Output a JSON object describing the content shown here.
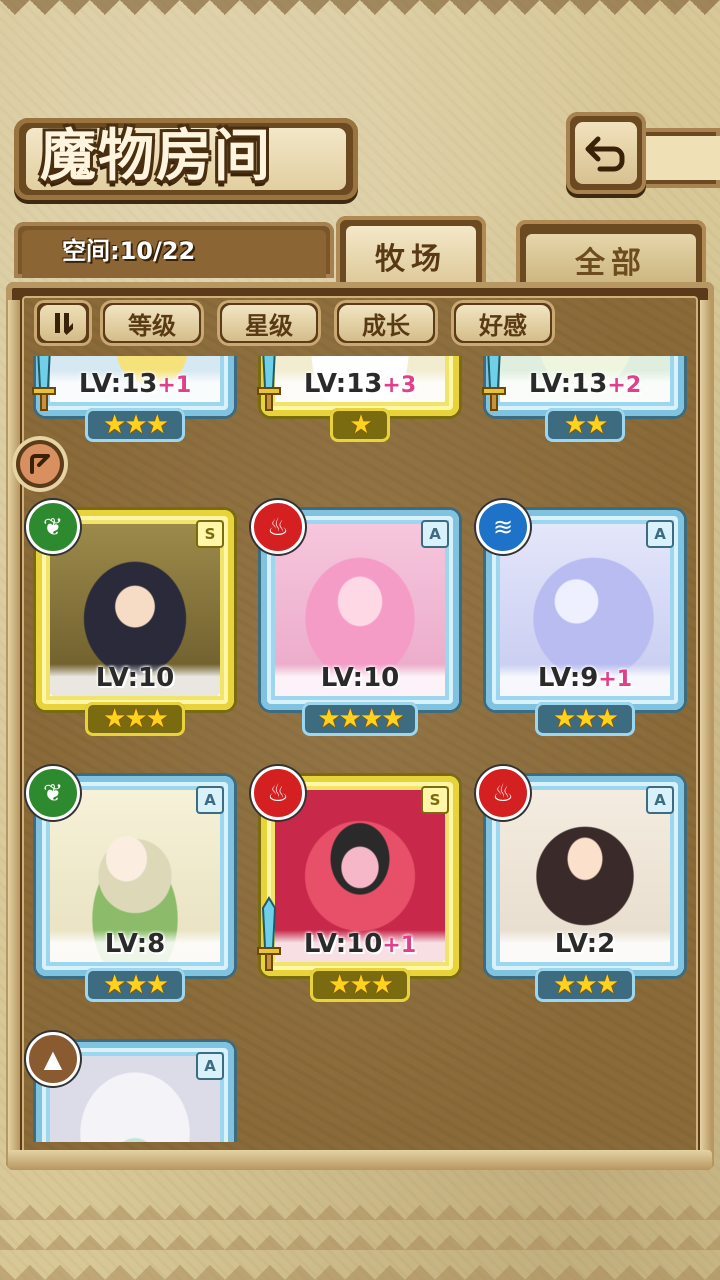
{
  "header": {
    "title": "魔物房间",
    "back_icon": "return-arrow-icon"
  },
  "capacity": {
    "text": "空间:10/22"
  },
  "tabs": [
    {
      "label": "牧场",
      "active": true
    },
    {
      "label": "全部",
      "active": false
    }
  ],
  "sort": {
    "toggle_icon": "pause-sort-icon",
    "buttons": [
      {
        "label": "等级"
      },
      {
        "label": "星级"
      },
      {
        "label": "成长"
      },
      {
        "label": "好感"
      }
    ]
  },
  "monsters": [
    {
      "lv": "LV:13",
      "plus": "+1",
      "stars": "★★★",
      "frame": "blue",
      "element": "",
      "rank": "",
      "weapon": true,
      "partial": true
    },
    {
      "lv": "LV:13",
      "plus": "+3",
      "stars": "★",
      "frame": "gold",
      "element": "",
      "rank": "",
      "weapon": true,
      "partial": true
    },
    {
      "lv": "LV:13",
      "plus": "+2",
      "stars": "★★",
      "frame": "blue",
      "element": "",
      "rank": "",
      "weapon": true,
      "partial": true
    },
    {
      "lv": "LV:10",
      "plus": "",
      "stars": "★★★",
      "frame": "gold",
      "element": "nature",
      "rank": "S",
      "weapon": false
    },
    {
      "lv": "LV:10",
      "plus": "",
      "stars": "★★★★",
      "frame": "blue",
      "element": "fire",
      "rank": "A",
      "weapon": false
    },
    {
      "lv": "LV:9",
      "plus": "+1",
      "stars": "★★★",
      "frame": "blue",
      "element": "water",
      "rank": "A",
      "weapon": false
    },
    {
      "lv": "LV:8",
      "plus": "",
      "stars": "★★★",
      "frame": "blue",
      "element": "nature",
      "rank": "A",
      "weapon": false
    },
    {
      "lv": "LV:10",
      "plus": "+1",
      "stars": "★★★",
      "frame": "gold",
      "element": "fire",
      "rank": "S",
      "weapon": true
    },
    {
      "lv": "LV:2",
      "plus": "",
      "stars": "★★★",
      "frame": "blue",
      "element": "fire",
      "rank": "A",
      "weapon": false
    },
    {
      "lv": "",
      "plus": "",
      "stars": "",
      "frame": "blue",
      "element": "earth",
      "rank": "A",
      "weapon": false,
      "partial": true
    }
  ],
  "colors": {
    "blue_frame": "#7fc3e0",
    "gold_frame": "#e8d43a",
    "plus_text": "#e0408a",
    "star": "#ffd21e"
  }
}
